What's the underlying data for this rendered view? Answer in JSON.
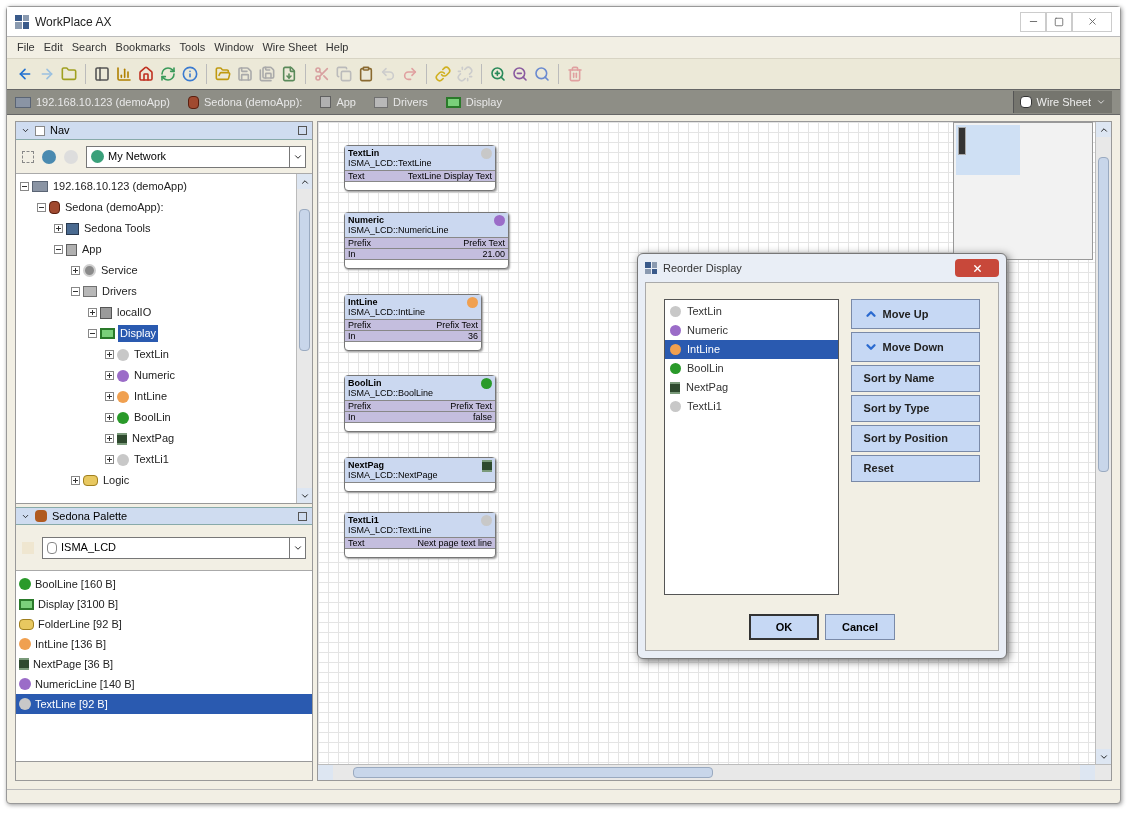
{
  "window": {
    "title": "WorkPlace AX"
  },
  "menu": [
    "File",
    "Edit",
    "Search",
    "Bookmarks",
    "Tools",
    "Window",
    "Wire Sheet",
    "Help"
  ],
  "breadcrumb": [
    {
      "label": "192.168.10.123 (demoApp)",
      "kind": "host"
    },
    {
      "label": "Sedona (demoApp):",
      "kind": "sedona"
    },
    {
      "label": "App",
      "kind": "app"
    },
    {
      "label": "Drivers",
      "kind": "drivers"
    },
    {
      "label": "Display",
      "kind": "display"
    }
  ],
  "view_selector": {
    "label": "Wire Sheet"
  },
  "nav": {
    "title": "Nav",
    "network": "My Network",
    "tree": [
      {
        "label": "192.168.10.123 (demoApp)",
        "kind": "host",
        "expanded": true,
        "selected": false,
        "children": [
          {
            "label": "Sedona (demoApp):",
            "kind": "sedona",
            "expanded": true,
            "selected": false,
            "children": [
              {
                "label": "Sedona Tools",
                "kind": "tools",
                "expanded": false,
                "selected": false
              },
              {
                "label": "App",
                "kind": "app",
                "expanded": true,
                "selected": false,
                "children": [
                  {
                    "label": "Service",
                    "kind": "gear",
                    "expanded": false,
                    "selected": false
                  },
                  {
                    "label": "Drivers",
                    "kind": "drivers",
                    "expanded": true,
                    "selected": false,
                    "children": [
                      {
                        "label": "localIO",
                        "kind": "io",
                        "expanded": false,
                        "selected": false
                      },
                      {
                        "label": "Display",
                        "kind": "display",
                        "expanded": true,
                        "selected": true,
                        "children": [
                          {
                            "label": "TextLin",
                            "kind": "dot",
                            "color": "#c8c8c8",
                            "expanded": false,
                            "selected": false
                          },
                          {
                            "label": "Numeric",
                            "kind": "dot",
                            "color": "#9b6cc8",
                            "expanded": false,
                            "selected": false
                          },
                          {
                            "label": "IntLine",
                            "kind": "dot",
                            "color": "#f0a050",
                            "expanded": false,
                            "selected": false
                          },
                          {
                            "label": "BoolLin",
                            "kind": "dot",
                            "color": "#2a9a2a",
                            "expanded": false,
                            "selected": false
                          },
                          {
                            "label": "NextPag",
                            "kind": "page",
                            "expanded": false,
                            "selected": false
                          },
                          {
                            "label": "TextLi1",
                            "kind": "dot",
                            "color": "#c8c8c8",
                            "expanded": false,
                            "selected": false
                          }
                        ]
                      }
                    ]
                  },
                  {
                    "label": "Logic",
                    "kind": "folder",
                    "expanded": false,
                    "selected": false
                  }
                ]
              }
            ]
          }
        ]
      }
    ]
  },
  "palette": {
    "title": "Sedona Palette",
    "kit": "ISMA_LCD",
    "items": [
      {
        "label": "BoolLine [160 B]",
        "kind": "dot",
        "color": "#2a9a2a",
        "selected": false
      },
      {
        "label": "Display [3100 B]",
        "kind": "display",
        "selected": false
      },
      {
        "label": "FolderLine [92 B]",
        "kind": "folder",
        "selected": false
      },
      {
        "label": "IntLine [136 B]",
        "kind": "dot",
        "color": "#f0a050",
        "selected": false
      },
      {
        "label": "NextPage [36 B]",
        "kind": "page",
        "selected": false
      },
      {
        "label": "NumericLine [140 B]",
        "kind": "dot",
        "color": "#9b6cc8",
        "selected": false
      },
      {
        "label": "TextLine [92 B]",
        "kind": "dot",
        "color": "#c8c8c8",
        "selected": true
      }
    ]
  },
  "wiresheet": {
    "nodes": [
      {
        "title": "TextLin",
        "type": "ISMA_LCD::TextLine",
        "kind": "dot",
        "color": "#c8c8c8",
        "slots": [
          {
            "name": "Text",
            "value": "TextLine Display Text"
          }
        ]
      },
      {
        "title": "Numeric",
        "type": "ISMA_LCD::NumericLine",
        "kind": "dot",
        "color": "#9b6cc8",
        "slots": [
          {
            "name": "Prefix",
            "value": "Prefix Text"
          },
          {
            "name": "In",
            "value": "21.00"
          }
        ]
      },
      {
        "title": "IntLine",
        "type": "ISMA_LCD::IntLine",
        "kind": "dot",
        "color": "#f0a050",
        "slots": [
          {
            "name": "Prefix",
            "value": "Prefix Text"
          },
          {
            "name": "In",
            "value": "36"
          }
        ]
      },
      {
        "title": "BoolLin",
        "type": "ISMA_LCD::BoolLine",
        "kind": "dot",
        "color": "#2a9a2a",
        "slots": [
          {
            "name": "Prefix",
            "value": "Prefix Text"
          },
          {
            "name": "In",
            "value": "false"
          }
        ]
      },
      {
        "title": "NextPag",
        "type": "ISMA_LCD::NextPage",
        "kind": "page"
      },
      {
        "title": "TextLi1",
        "type": "ISMA_LCD::TextLine",
        "kind": "dot",
        "color": "#c8c8c8",
        "slots": [
          {
            "name": "Text",
            "value": "Next page text line"
          }
        ]
      }
    ]
  },
  "dialog": {
    "title": "Reorder Display",
    "items": [
      {
        "label": "TextLin",
        "kind": "dot",
        "color": "#c8c8c8",
        "selected": false
      },
      {
        "label": "Numeric",
        "kind": "dot",
        "color": "#9b6cc8",
        "selected": false
      },
      {
        "label": "IntLine",
        "kind": "dot",
        "color": "#f0a050",
        "selected": true
      },
      {
        "label": "BoolLin",
        "kind": "dot",
        "color": "#2a9a2a",
        "selected": false
      },
      {
        "label": "NextPag",
        "kind": "page",
        "selected": false
      },
      {
        "label": "TextLi1",
        "kind": "dot",
        "color": "#c8c8c8",
        "selected": false
      }
    ],
    "actions": [
      {
        "label": "Move Up",
        "kind": "up"
      },
      {
        "label": "Move Down",
        "kind": "down"
      },
      {
        "label": "Sort by Name",
        "kind": "plain"
      },
      {
        "label": "Sort by Type",
        "kind": "plain"
      },
      {
        "label": "Sort by Position",
        "kind": "plain"
      },
      {
        "label": "Reset",
        "kind": "plain"
      }
    ],
    "buttons": [
      "OK",
      "Cancel"
    ]
  }
}
